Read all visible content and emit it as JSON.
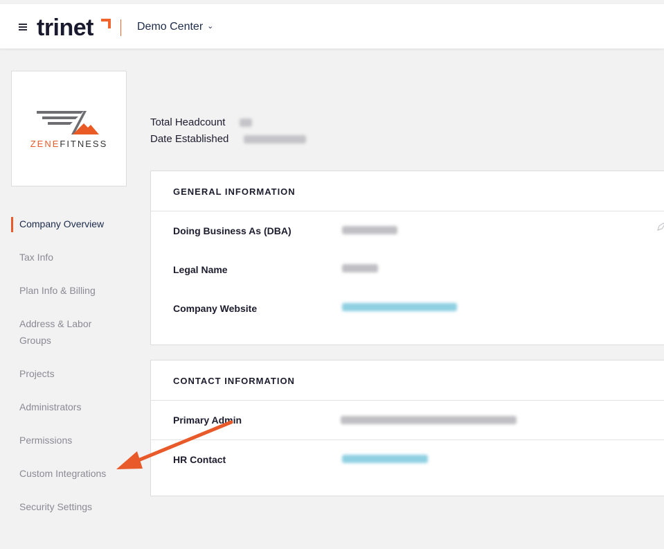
{
  "header": {
    "logo_text": "trinet",
    "account_switcher": "Demo Center"
  },
  "company_logo": {
    "name_prefix": "ZENE",
    "name_suffix": "FITNESS"
  },
  "sidebar": {
    "items": [
      {
        "label": "Company Overview",
        "active": true
      },
      {
        "label": "Tax Info",
        "active": false
      },
      {
        "label": "Plan Info & Billing",
        "active": false
      },
      {
        "label": "Address & Labor Groups",
        "active": false
      },
      {
        "label": "Projects",
        "active": false
      },
      {
        "label": "Administrators",
        "active": false
      },
      {
        "label": "Permissions",
        "active": false
      },
      {
        "label": "Custom Integrations",
        "active": false
      },
      {
        "label": "Security Settings",
        "active": false
      }
    ]
  },
  "summary": {
    "headcount_label": "Total Headcount",
    "established_label": "Date Established"
  },
  "general_info": {
    "title": "GENERAL INFORMATION",
    "fields": {
      "dba_label": "Doing Business As (DBA)",
      "legal_name_label": "Legal Name",
      "website_label": "Company Website"
    }
  },
  "contact_info": {
    "title": "CONTACT INFORMATION",
    "fields": {
      "primary_admin_label": "Primary Admin",
      "hr_contact_label": "HR Contact"
    }
  },
  "colors": {
    "accent": "#e85a2a",
    "link_blur": "#7cc6dc",
    "text_blur": "#b8b8bc"
  },
  "icons": [
    "hamburger-icon",
    "chevron-down-icon",
    "edit-pencil-icon"
  ]
}
